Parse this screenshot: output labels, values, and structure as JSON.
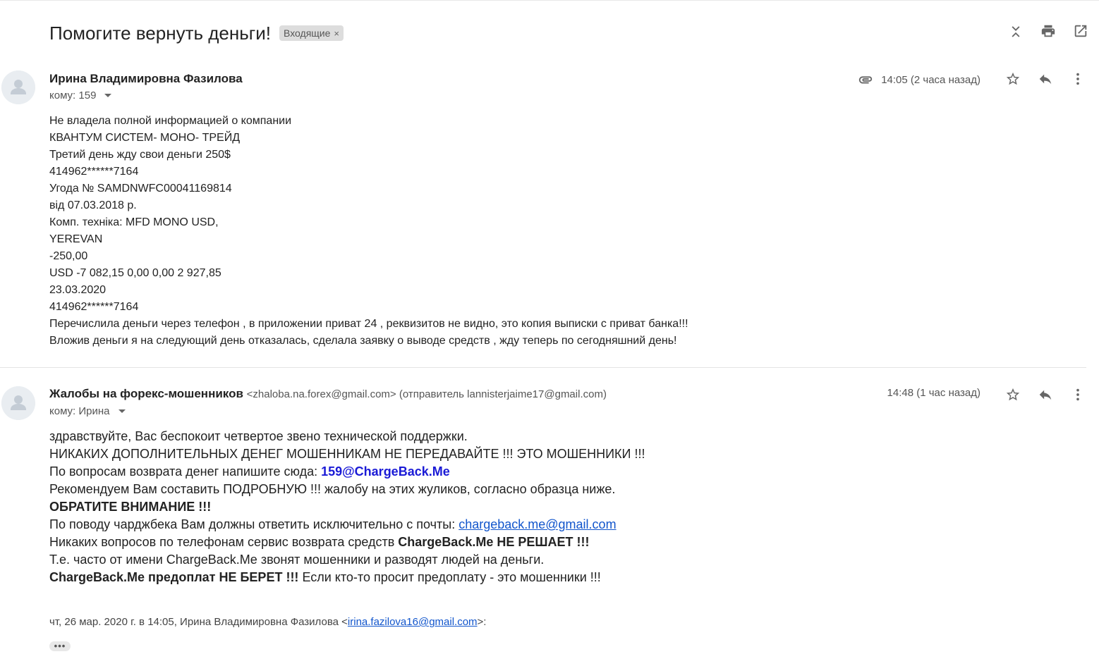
{
  "header": {
    "subject": "Помогите вернуть деньги!",
    "label": "Входящие",
    "label_close": "×",
    "actions": [
      "collapse-icon",
      "print-icon",
      "open-in-new-window-icon"
    ]
  },
  "messages": [
    {
      "sender_name": "Ирина Владимировна Фазилова",
      "to_label": "кому: 159",
      "time": "14:05 (2 часа назад)",
      "has_attachment": true,
      "body_lines": [
        "Не владела полной информацией о компании",
        "КВАНТУМ СИСТЕМ- МОНО- ТРЕЙД",
        "Третий день жду свои деньги 250$",
        "414962******7164",
        "Угода № SAMDNWFC00041169814",
        "від 07.03.2018 р.",
        "Комп. техніка: MFD MONO USD,",
        "YEREVAN",
        "-250,00",
        "USD -7 082,15 0,00 0,00 2 927,85",
        "23.03.2020",
        "414962******7164",
        "Перечислила деньги через телефон , в приложении приват 24 , реквизитов не видно,  это копия выписки с приват банка!!!",
        "Вложив деньги я на следующий день отказалась, сделала заявку о выводе средств , жду теперь по сегодняшний день!"
      ]
    },
    {
      "sender_name": "Жалобы на форекс-мошенников",
      "sender_email": "<zhaloba.na.forex@gmail.com> (отправитель lannisterjaime17@gmail.com)",
      "to_label": "кому: Ирина",
      "time": "14:48 (1 час назад)",
      "body": {
        "l1": "здравствуйте, Вас беспокоит четвертое звено технической поддержки.",
        "l2": "НИКАКИХ ДОПОЛНИТЕЛЬНЫХ ДЕНЕГ МОШЕННИКАМ НЕ ПЕРЕДАВАЙТЕ !!! ЭТО МОШЕННИКИ !!!",
        "l3_prefix": "По вопросам возврата денег напишите сюда: ",
        "l3_email": "159@ChargeBack.Me",
        "l4": "Рекомендуем Вам составить ПОДРОБНУЮ !!! жалобу на этих жуликов, согласно образца ниже.",
        "l5": "ОБРАТИТЕ ВНИМАНИЕ !!!",
        "l6_prefix": "По поводу чарджбека Вам должны ответить исключительно с почты: ",
        "l6_link": "chargeback.me@gmail.com",
        "l7_prefix": "Никаких вопросов по телефонам сервис возврата средств ",
        "l7_bold": "ChargeBack.Me НЕ РЕШАЕТ !!!",
        "l8": "Т.е. часто от имени ChargeBack.Me звонят мошенники и разводят людей на деньги.",
        "l9_bold": "ChargeBack.Me предоплат НЕ БЕРЕТ !!!",
        "l9_suffix": " Если кто-то просит предоплату - это мошенники !!!"
      },
      "quote_prefix": "чт, 26 мар. 2020 г. в 14:05, Ирина Владимировна Фазилова <",
      "quote_email": "irina.fazilova16@gmail.com",
      "quote_suffix": ">:",
      "show_trimmed": "•••"
    }
  ],
  "colors": {
    "link": "#1155cc",
    "blue_bold": "#1a1ad6",
    "chip_bg": "#dddddd"
  }
}
